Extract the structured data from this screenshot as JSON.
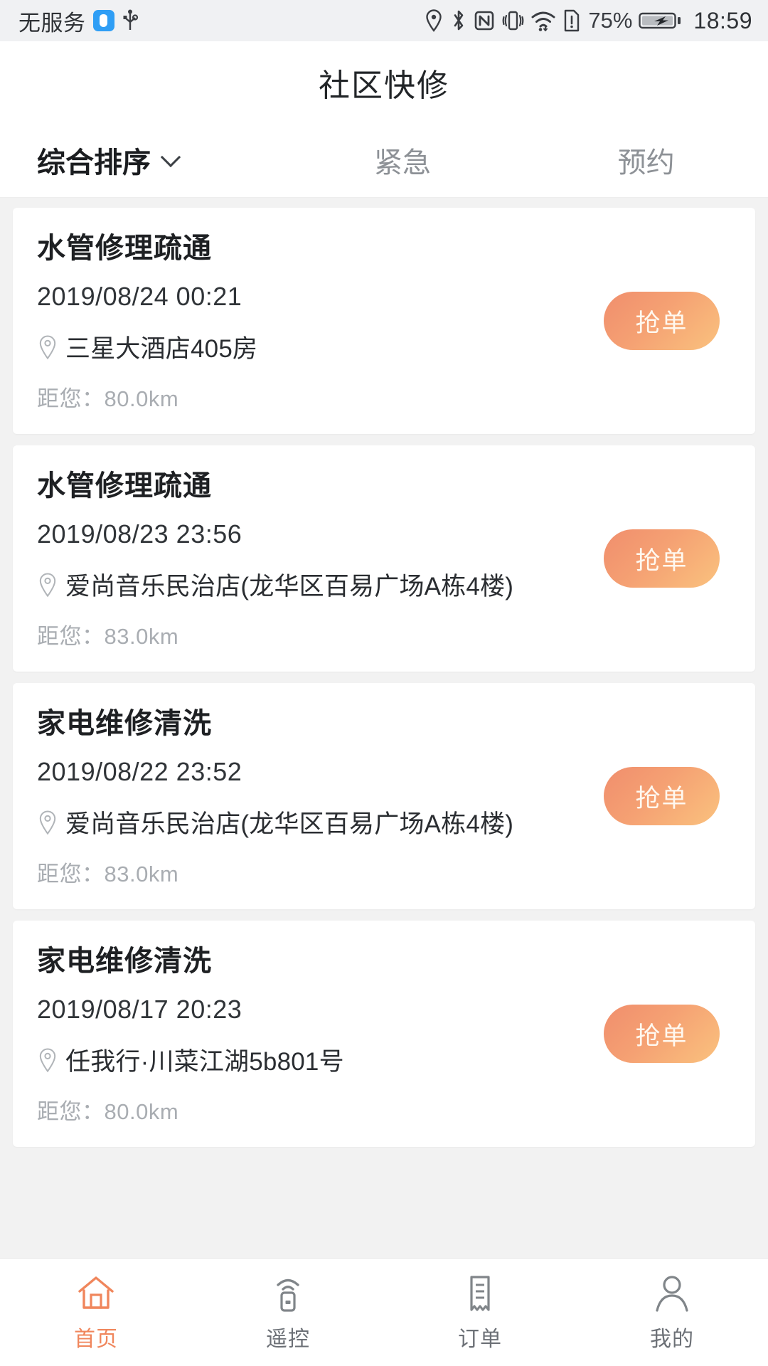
{
  "statusbar": {
    "carrier": "无服务",
    "icons": [
      "shield-icon",
      "usb-icon",
      "location-icon",
      "bluetooth-icon",
      "nfc-icon",
      "vibrate-icon",
      "wifi-icon",
      "sim-alert-icon"
    ],
    "battery_percent": "75%",
    "battery_state": "charging",
    "clock": "18:59"
  },
  "header": {
    "title": "社区快修"
  },
  "tabs": [
    {
      "label": "综合排序",
      "active": true,
      "has_chevron": true
    },
    {
      "label": "紧急",
      "active": false,
      "has_chevron": false
    },
    {
      "label": "预约",
      "active": false,
      "has_chevron": false
    }
  ],
  "orders": [
    {
      "title": "水管修理疏通",
      "time": "2019/08/24 00:21",
      "address": "三星大酒店405房",
      "distance": "距您：80.0km",
      "action_label": "抢单"
    },
    {
      "title": "水管修理疏通",
      "time": "2019/08/23 23:56",
      "address": "爱尚音乐民治店(龙华区百易广场A栋4楼)",
      "distance": "距您：83.0km",
      "action_label": "抢单"
    },
    {
      "title": "家电维修清洗",
      "time": "2019/08/22 23:52",
      "address": "爱尚音乐民治店(龙华区百易广场A栋4楼)",
      "distance": "距您：83.0km",
      "action_label": "抢单"
    },
    {
      "title": "家电维修清洗",
      "time": "2019/08/17 20:23",
      "address": "任我行·川菜江湖5b801号",
      "distance": "距您：80.0km",
      "action_label": "抢单"
    }
  ],
  "bottomnav": [
    {
      "label": "首页",
      "icon": "home-icon",
      "active": true
    },
    {
      "label": "遥控",
      "icon": "remote-control-icon",
      "active": false
    },
    {
      "label": "订单",
      "icon": "receipt-icon",
      "active": false
    },
    {
      "label": "我的",
      "icon": "person-icon",
      "active": false
    }
  ],
  "colors": {
    "accent": "#f0865c",
    "button_gradient_start": "#f08e6d",
    "button_gradient_end": "#fac27e",
    "page_bg": "#f2f2f2",
    "card_bg": "#ffffff",
    "muted_text": "#a9adb2"
  }
}
